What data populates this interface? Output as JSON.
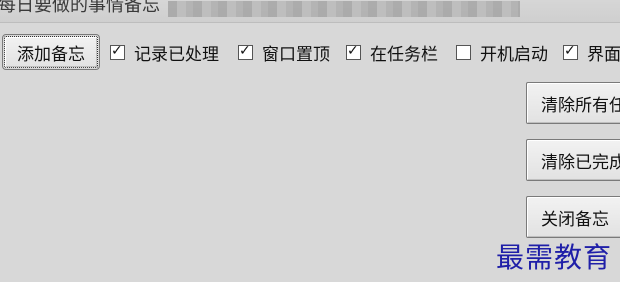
{
  "window": {
    "title_partial": "每日要做的事情备忘"
  },
  "toolbar": {
    "add_button": "添加备忘",
    "checkboxes": [
      {
        "label": "记录已处理",
        "checked": true
      },
      {
        "label": "窗口置顶",
        "checked": true
      },
      {
        "label": "在任务栏",
        "checked": true
      },
      {
        "label": "开机启动",
        "checked": false
      },
      {
        "label": "界面",
        "checked": true
      }
    ]
  },
  "actions": {
    "clear_all": "清除所有任",
    "clear_done": "清除已完成",
    "close_memo": "关闭备忘"
  },
  "watermark": "最需教育",
  "colors": {
    "background": "#d8d8d8",
    "watermark": "#1f1fa8"
  },
  "icons": {
    "checked": "checkbox-checked-icon",
    "unchecked": "checkbox-unchecked-icon"
  }
}
